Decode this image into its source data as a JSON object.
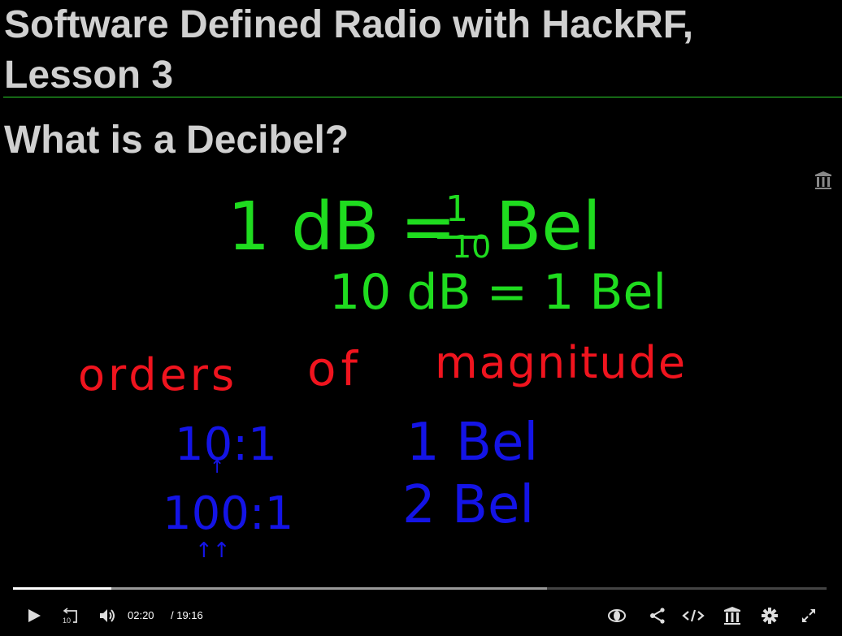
{
  "header": {
    "title_line1": "Software Defined Radio with HackRF,",
    "title_line2": "Lesson 3",
    "subtitle": "What is a Decibel?"
  },
  "whiteboard": {
    "line1_lhs": "1 dB =",
    "frac_num": "1",
    "frac_den": "10",
    "line1_rhs": "Bel",
    "line2": "10 dB = 1 Bel",
    "line3a": "orders",
    "line3b": "of",
    "line3c": "magnitude",
    "ratio1": "10:1",
    "ratio2": "100:1",
    "bel1": "1 Bel",
    "bel2": "2 Bel",
    "arrow1": "↑",
    "arrow2": "↑↑"
  },
  "player": {
    "current_time": "02:20",
    "duration": "/ 19:16",
    "played_fraction": 0.121,
    "buffered_fraction": 0.656,
    "skip_seconds": "10"
  }
}
